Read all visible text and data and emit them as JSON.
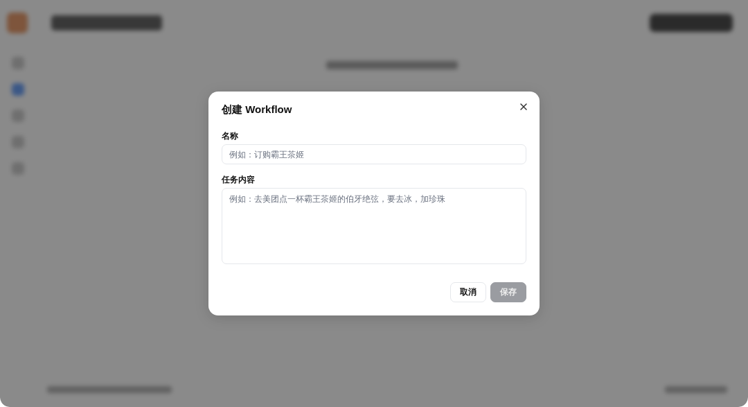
{
  "sidebar": {
    "items": [
      {
        "selected": false
      },
      {
        "selected": true
      },
      {
        "selected": false
      },
      {
        "selected": false
      },
      {
        "selected": false
      }
    ]
  },
  "dialog": {
    "title": "创建 Workflow",
    "fields": [
      {
        "kind": "input",
        "label": "名称",
        "placeholder": "例如：订购霸王茶姬"
      },
      {
        "kind": "textarea",
        "label": "任务内容",
        "placeholder": "例如：去美团点一杯霸王茶姬的伯牙绝弦，要去冰，加珍珠"
      }
    ],
    "buttons": [
      {
        "label": "取消",
        "kind": "secondary",
        "disabled": false
      },
      {
        "label": "保存",
        "kind": "primary",
        "disabled": true
      }
    ]
  }
}
